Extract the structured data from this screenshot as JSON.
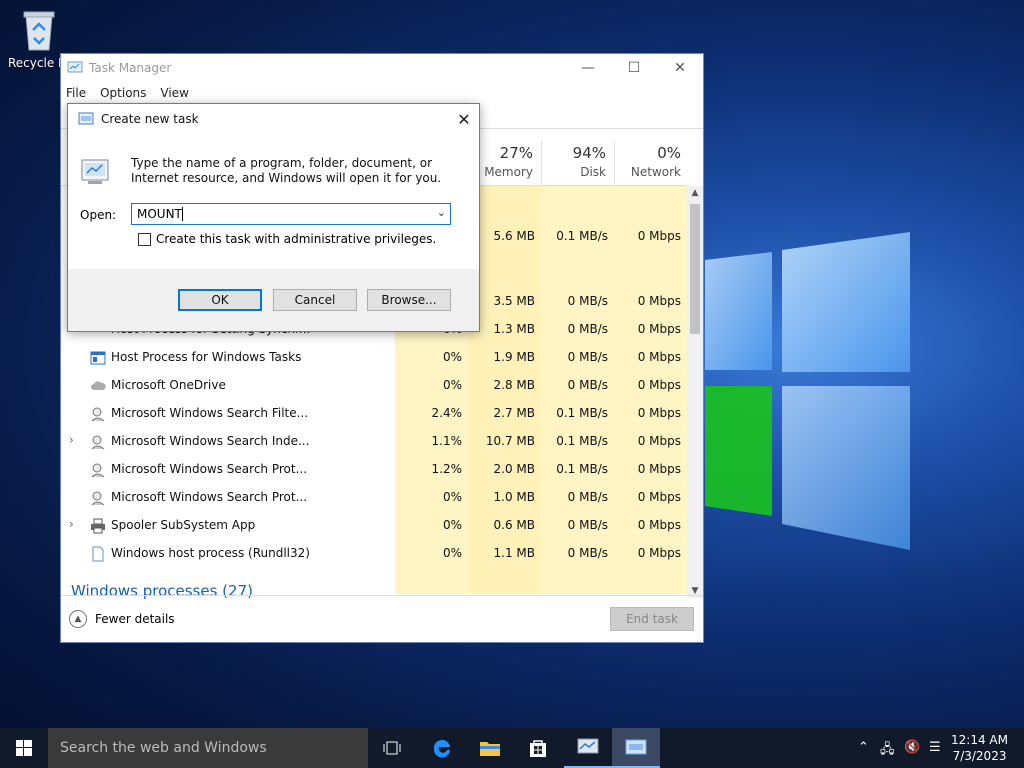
{
  "desktop": {
    "recycle_bin_label": "Recycle Bin"
  },
  "task_manager": {
    "title": "Task Manager",
    "menu": [
      "File",
      "Options",
      "View"
    ],
    "columns": [
      {
        "pct": "27%",
        "label": "Memory"
      },
      {
        "pct": "94%",
        "label": "Disk"
      },
      {
        "pct": "0%",
        "label": "Network"
      }
    ],
    "rows": [
      {
        "name": "",
        "cpu": "",
        "memory": "5.6 MB",
        "disk": "0.1 MB/s",
        "network": "0 Mbps"
      },
      {
        "name": "",
        "cpu": "",
        "memory": "3.5 MB",
        "disk": "0 MB/s",
        "network": "0 Mbps"
      },
      {
        "name": "Host Process for Setting Synchr...",
        "cpu": "0%",
        "memory": "1.3 MB",
        "disk": "0 MB/s",
        "network": "0 Mbps"
      },
      {
        "name": "Host Process for Windows Tasks",
        "cpu": "0%",
        "memory": "1.9 MB",
        "disk": "0 MB/s",
        "network": "0 Mbps"
      },
      {
        "name": "Microsoft OneDrive",
        "cpu": "0%",
        "memory": "2.8 MB",
        "disk": "0 MB/s",
        "network": "0 Mbps"
      },
      {
        "name": "Microsoft Windows Search Filte...",
        "cpu": "2.4%",
        "memory": "2.7 MB",
        "disk": "0.1 MB/s",
        "network": "0 Mbps"
      },
      {
        "name": "Microsoft Windows Search Inde...",
        "cpu": "1.1%",
        "memory": "10.7 MB",
        "disk": "0.1 MB/s",
        "network": "0 Mbps"
      },
      {
        "name": "Microsoft Windows Search Prot...",
        "cpu": "1.2%",
        "memory": "2.0 MB",
        "disk": "0.1 MB/s",
        "network": "0 Mbps"
      },
      {
        "name": "Microsoft Windows Search Prot...",
        "cpu": "0%",
        "memory": "1.0 MB",
        "disk": "0 MB/s",
        "network": "0 Mbps"
      },
      {
        "name": "Spooler SubSystem App",
        "cpu": "0%",
        "memory": "0.6 MB",
        "disk": "0 MB/s",
        "network": "0 Mbps"
      },
      {
        "name": "Windows host process (Rundll32)",
        "cpu": "0%",
        "memory": "1.1 MB",
        "disk": "0 MB/s",
        "network": "0 Mbps"
      }
    ],
    "group_header": "Windows processes (27)",
    "fewer_details": "Fewer details",
    "end_task": "End task"
  },
  "dialog": {
    "title": "Create new task",
    "description": "Type the name of a program, folder, document, or Internet resource, and Windows will open it for you.",
    "open_label": "Open:",
    "open_value": "MOUNT",
    "admin_checkbox_label": "Create this task with administrative privileges.",
    "ok": "OK",
    "cancel": "Cancel",
    "browse": "Browse..."
  },
  "taskbar": {
    "search_placeholder": "Search the web and Windows",
    "time": "12:14 AM",
    "date": "7/3/2023"
  }
}
